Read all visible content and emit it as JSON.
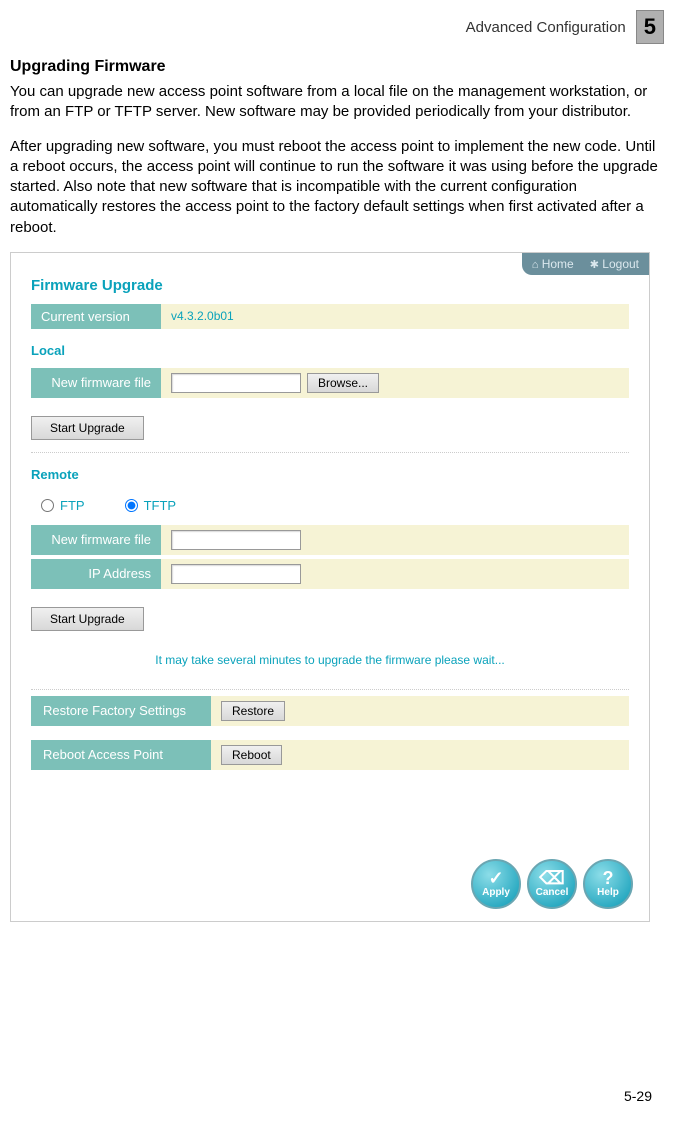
{
  "header": {
    "breadcrumb": "Advanced Configuration",
    "chapter_num": "5"
  },
  "doc": {
    "section_title": "Upgrading Firmware",
    "para1": "You can upgrade new access point software from a local file on the management workstation, or from an FTP or TFTP server. New software may be provided periodically from your distributor.",
    "para2": "After upgrading new software, you must reboot the access point to implement the new code. Until a reboot occurs, the access point will continue to run the software it was using before the upgrade started. Also note that new software that is incompatible with the current configuration automatically restores the access point to the factory default settings when first activated after a reboot."
  },
  "ui": {
    "topbar": {
      "home": "Home",
      "logout": "Logout"
    },
    "title": "Firmware Upgrade",
    "current_version_label": "Current version",
    "current_version_value": "v4.3.2.0b01",
    "local_label": "Local",
    "new_fw_label": "New firmware file",
    "browse": "Browse...",
    "start_upgrade": "Start Upgrade",
    "remote_label": "Remote",
    "ftp": "FTP",
    "tftp": "TFTP",
    "ip_address_label": "IP Address",
    "wait_msg": "It may take several minutes to upgrade the firmware please wait...",
    "restore_label": "Restore Factory Settings",
    "restore_btn": "Restore",
    "reboot_label": "Reboot Access Point",
    "reboot_btn": "Reboot",
    "apply": "Apply",
    "cancel": "Cancel",
    "help": "Help"
  },
  "footer": {
    "page_num": "5-29"
  }
}
